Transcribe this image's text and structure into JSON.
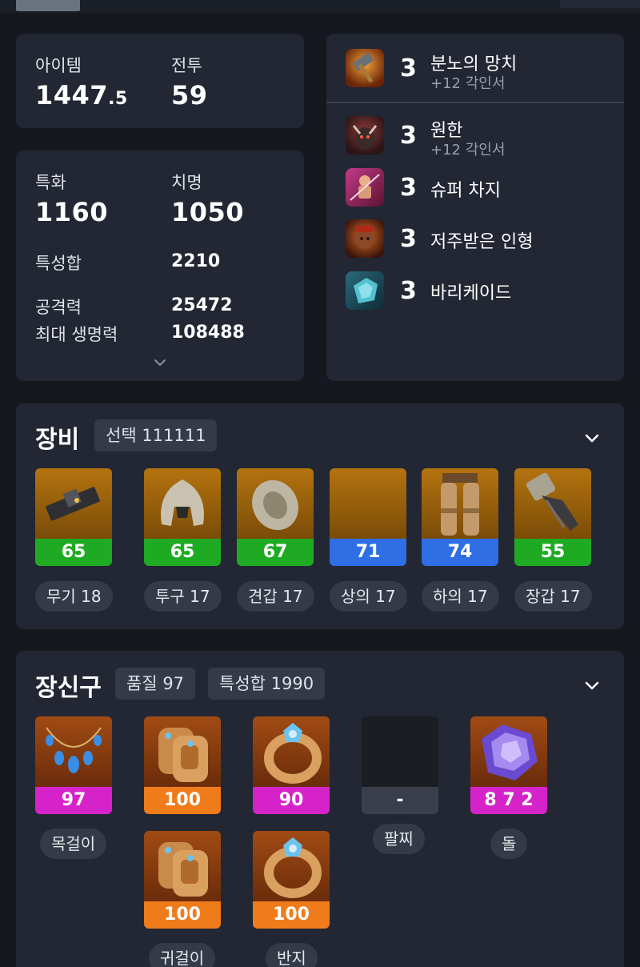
{
  "stats": {
    "item_level_label": "아이템",
    "item_level_int": "1447",
    "item_level_frac": ".5",
    "combat_label": "전투",
    "combat_value": "59",
    "specialization_label": "특화",
    "specialization_value": "1160",
    "crit_label": "치명",
    "crit_value": "1050",
    "stat_sum_label": "특성합",
    "stat_sum_value": "2210",
    "attack_label": "공격력",
    "attack_value": "25472",
    "max_hp_label": "최대 생명력",
    "max_hp_value": "108488"
  },
  "engravings": [
    {
      "level": "3",
      "name": "분노의 망치",
      "sub": "+12 각인서",
      "icon": "hammer-icon"
    },
    {
      "level": "3",
      "name": "원한",
      "sub": "+12 각인서",
      "icon": "grudge-icon"
    },
    {
      "level": "3",
      "name": "슈퍼 차지",
      "sub": "",
      "icon": "super-charge-icon"
    },
    {
      "level": "3",
      "name": "저주받은 인형",
      "sub": "",
      "icon": "cursed-doll-icon"
    },
    {
      "level": "3",
      "name": "바리케이드",
      "sub": "",
      "icon": "barricade-icon"
    }
  ],
  "equipment": {
    "title": "장비",
    "tag": "선택 111111",
    "items": [
      {
        "quality": "65",
        "label": "무기 18",
        "bar_color": "#1faa23",
        "icon": "weapon-icon"
      },
      {
        "quality": "65",
        "label": "투구 17",
        "bar_color": "#1faa23",
        "icon": "helmet-icon"
      },
      {
        "quality": "67",
        "label": "견갑 17",
        "bar_color": "#1faa23",
        "icon": "shoulder-icon"
      },
      {
        "quality": "71",
        "label": "상의 17",
        "bar_color": "#2f6fe6",
        "icon": "chest-icon"
      },
      {
        "quality": "74",
        "label": "하의 17",
        "bar_color": "#2f6fe6",
        "icon": "pants-icon"
      },
      {
        "quality": "55",
        "label": "장갑 17",
        "bar_color": "#1faa23",
        "icon": "gloves-icon"
      }
    ]
  },
  "accessories": {
    "title": "장신구",
    "tag_quality": "품질 97",
    "tag_stat": "특성합 1990",
    "items": [
      {
        "quality": "97",
        "label": "목걸이",
        "bar_color": "#d523c9",
        "icon": "necklace-icon"
      },
      {
        "quality": "100",
        "label": "",
        "bar_color": "#f07b1a",
        "icon": "earring-icon"
      },
      {
        "quality": "90",
        "label": "",
        "bar_color": "#d523c9",
        "icon": "ring-icon"
      },
      {
        "quality": "-",
        "label": "팔찌",
        "bar_color": "#3a3f4b",
        "icon": "bracelet-empty-icon"
      },
      {
        "quality": "8 7 2",
        "label": "돌",
        "bar_color": "#d523c9",
        "icon": "stone-icon"
      },
      {
        "quality": "100",
        "label": "귀걸이",
        "bar_color": "#f07b1a",
        "icon": "earring-icon"
      },
      {
        "quality": "100",
        "label": "반지",
        "bar_color": "#f07b1a",
        "icon": "ring-icon"
      }
    ]
  }
}
